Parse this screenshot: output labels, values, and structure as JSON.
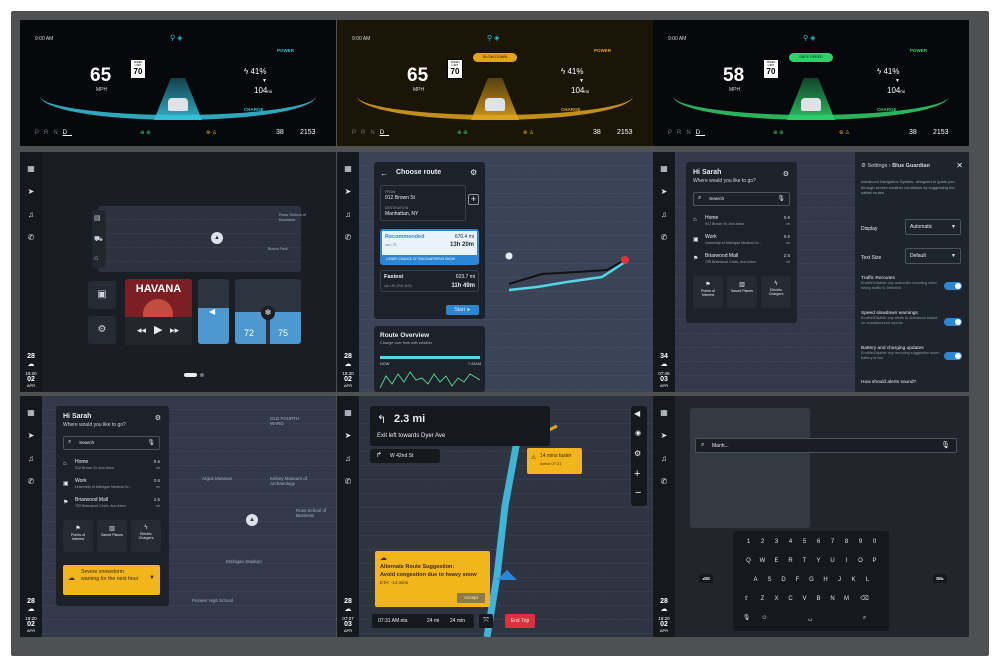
{
  "dash": [
    {
      "time": "9:00 AM",
      "power": "POWER",
      "charge": "CHARGE",
      "speed": "65",
      "unit": "MPH",
      "limit_label": "SPEED LIMIT",
      "limit": "70",
      "battery": "41",
      "battery_unit": "%",
      "range": "104",
      "range_unit": "mi",
      "gears": [
        "P",
        "R",
        "N",
        "D"
      ],
      "temp": "38",
      "temp_unit": "°F",
      "odo": "2153",
      "odo_unit": "mi",
      "badge": "",
      "accent": "#36c3dc"
    },
    {
      "time": "9:00 AM",
      "power": "POWER",
      "charge": "CHARGE",
      "speed": "65",
      "unit": "MPH",
      "limit_label": "SPEED LIMIT",
      "limit": "70",
      "battery": "41",
      "battery_unit": "%",
      "range": "104",
      "range_unit": "mi",
      "gears": [
        "P",
        "R",
        "N",
        "D"
      ],
      "temp": "38",
      "temp_unit": "°F",
      "odo": "2153",
      "odo_unit": "mi",
      "badge": "SLOW DOWN",
      "accent": "#e0a51d"
    },
    {
      "time": "9:00 AM",
      "power": "POWER",
      "charge": "CHARGE",
      "speed": "58",
      "unit": "MPH",
      "limit_label": "SPEED LIMIT",
      "limit": "70",
      "battery": "41",
      "battery_unit": "%",
      "range": "104",
      "range_unit": "mi",
      "gears": [
        "P",
        "R",
        "N",
        "D"
      ],
      "temp": "38",
      "temp_unit": "°F",
      "odo": "2153",
      "odo_unit": "mi",
      "badge": "SAFE SPEED",
      "accent": "#2fd16b"
    }
  ],
  "weather": [
    {
      "temp": "28",
      "time": "19:20",
      "day": "02",
      "month": "APR"
    },
    {
      "temp": "28",
      "time": "19:20",
      "day": "02",
      "month": "APR"
    },
    {
      "temp": "34",
      "time": "07:45",
      "day": "03",
      "month": "APR"
    },
    {
      "temp": "28",
      "time": "19:20",
      "day": "02",
      "month": "APR"
    },
    {
      "temp": "28",
      "time": "07:07",
      "day": "03",
      "month": "APR"
    },
    {
      "temp": "28",
      "time": "19:20",
      "day": "02",
      "month": "APR"
    }
  ],
  "media": {
    "album": "HAVANA",
    "vol_left": "72",
    "vol_right": "75"
  },
  "route": {
    "title": "Choose route",
    "from_label": "FROM",
    "from": "912 Brown St",
    "to_label": "DESTINATION",
    "to": "Manhattan, NY",
    "rec_label": "Recommended",
    "rec_dist": "670.4 mi",
    "rec_via": "via I-75",
    "rec_time": "13h 20m",
    "rec_note": "LOWER CHANCE OF ENCOUNTERING SNOW",
    "fast_label": "Fastest",
    "fast_dist": "623.7 mi",
    "fast_via": "via I-80 (Toll: $40)",
    "fast_time": "11h 49m",
    "start": "Start",
    "overview_title": "Route Overview",
    "overview_sub": "Change over time with weather",
    "now": "NOW",
    "end_time": "7:43AM"
  },
  "settings": {
    "breadcrumb_root": "Settings",
    "breadcrumb_page": "Blue Guardian",
    "desc": "Advanced Navigation System, designed to guide you through severe weather conditions by suggesting the safest routes",
    "display_label": "Display",
    "display_value": "Automatic",
    "text_label": "Text Size",
    "text_value": "Default",
    "reroute_title": "Traffic Reroutes",
    "reroute_desc": "Enable/Disable any automatic rerouting when heavy traffic is detected",
    "speed_title": "Speed slowdown warnings",
    "speed_desc": "Enable/Disable any alerts to slowdown based on crowdsourced reports",
    "batt_title": "Battery and charging updates",
    "batt_desc": "Enable/Disable any rerouting suggestion when battery is low",
    "alerts_q": "How should alerts sound?"
  },
  "greet": {
    "hi": "Hi Sarah",
    "ask": "Where would you like to go?",
    "search": "Search",
    "places": [
      {
        "name": "Home",
        "addr": "912 Brown St, Ann Arbor",
        "dist": "0.6",
        "unit": "mi"
      },
      {
        "name": "Work",
        "addr": "University of Michigan Medical Sc...",
        "dist": "0.6",
        "unit": "mi"
      },
      {
        "name": "Briarwood Mall",
        "addr": "755 Briarwood Circle, Ann Arbor",
        "dist": "2.5",
        "unit": "mi"
      }
    ],
    "cats": [
      "Points of Interest",
      "Saved Places",
      "Electric Chargers"
    ],
    "warning": "Severe snowstorm warning for the next hour"
  },
  "map_labels": [
    "OLD FOURTH WARD",
    "Argus Museum",
    "Kelsey Museum of Archaeology",
    "Ross School of Business",
    "Michigan Stadium",
    "Pioneer High School",
    "Burns Park",
    "Ross School of Business"
  ],
  "nav": {
    "dist": "2.3 mi",
    "instruction": "Exit left towards Dyer Ave",
    "next": "W 42nd St",
    "faster": "14 mins faster",
    "faster_sub": "Arrive 07:21",
    "alt_title": "Alternate Route Suggestion:",
    "alt_body": "Avoid congestion due to heavy snow",
    "alt_eta": "ETA: -14 mins",
    "accept": "Accept",
    "eta": "07:31 AM eta",
    "rem_dist": "24 mi",
    "rem_time": "24 min",
    "end": "End Trip"
  },
  "keyboard": {
    "query": "Manh...",
    "row1": [
      "1",
      "2",
      "3",
      "4",
      "5",
      "6",
      "7",
      "8",
      "9",
      "0"
    ],
    "row2": [
      "Q",
      "W",
      "E",
      "R",
      "T",
      "Y",
      "U",
      "I",
      "O",
      "P"
    ],
    "row3": [
      "A",
      "S",
      "D",
      "F",
      "G",
      "H",
      "J",
      "K",
      "L"
    ],
    "row4": [
      "Z",
      "X",
      "C",
      "V",
      "B",
      "N",
      "M"
    ]
  },
  "colors": {
    "accent": "#36c3dc",
    "amber": "#e0a51d",
    "green": "#2fd16b",
    "blue": "#2c86d6",
    "warning": "#f3b51c"
  }
}
